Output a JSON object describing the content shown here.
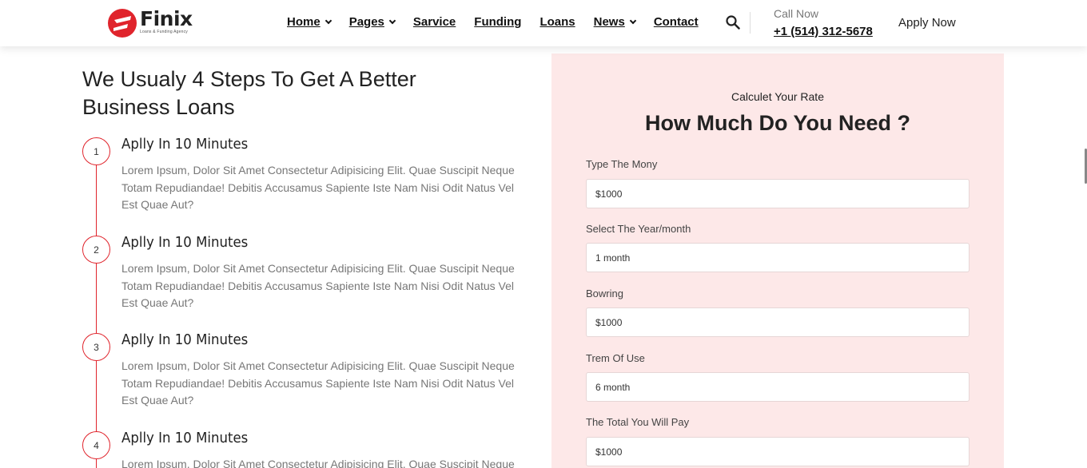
{
  "brand": {
    "name": "Finix",
    "tagline": "Loans & Funding Agency",
    "accent": "#e0242c"
  },
  "nav": {
    "items": [
      {
        "label": "Home",
        "dropdown": true
      },
      {
        "label": "Pages",
        "dropdown": true
      },
      {
        "label": "Sarvice",
        "dropdown": false
      },
      {
        "label": "Funding",
        "dropdown": false
      },
      {
        "label": "Loans",
        "dropdown": false
      },
      {
        "label": "News",
        "dropdown": true
      },
      {
        "label": "Contact",
        "dropdown": false
      }
    ],
    "search_icon": "search-icon",
    "call_label": "Call Now",
    "phone": "+1 (514) 312-5678",
    "apply": "Apply Now"
  },
  "steps": {
    "title": "We Usualy 4 Steps To Get A Better Business Loans",
    "items": [
      {
        "num": "1",
        "title": "Aplly In 10 Minutes",
        "text": "Lorem Ipsum, Dolor Sit Amet Consectetur Adipisicing Elit. Quae Suscipit Neque Totam Repudiandae! Debitis Accusamus Sapiente Iste Nam Nisi Odit Natus Vel Est Quae Aut?"
      },
      {
        "num": "2",
        "title": "Aplly In 10 Minutes",
        "text": "Lorem Ipsum, Dolor Sit Amet Consectetur Adipisicing Elit. Quae Suscipit Neque Totam Repudiandae! Debitis Accusamus Sapiente Iste Nam Nisi Odit Natus Vel Est Quae Aut?"
      },
      {
        "num": "3",
        "title": "Aplly In 10 Minutes",
        "text": "Lorem Ipsum, Dolor Sit Amet Consectetur Adipisicing Elit. Quae Suscipit Neque Totam Repudiandae! Debitis Accusamus Sapiente Iste Nam Nisi Odit Natus Vel Est Quae Aut?"
      },
      {
        "num": "4",
        "title": "Aplly In 10 Minutes",
        "text": "Lorem Ipsum, Dolor Sit Amet Consectetur Adipisicing Elit. Quae Suscipit Neque"
      }
    ]
  },
  "calculator": {
    "kicker": "Calculet Your Rate",
    "title": "How Much Do You Need ?",
    "panel_color": "#fde8e8",
    "fields": [
      {
        "label": "Type The Mony",
        "value": "$1000"
      },
      {
        "label": "Select The Year/month",
        "value": "1 month"
      },
      {
        "label": "Bowring",
        "value": "$1000"
      },
      {
        "label": "Trem Of Use",
        "value": "6 month"
      },
      {
        "label": "The Total You Will Pay",
        "value": "$1000"
      }
    ]
  }
}
